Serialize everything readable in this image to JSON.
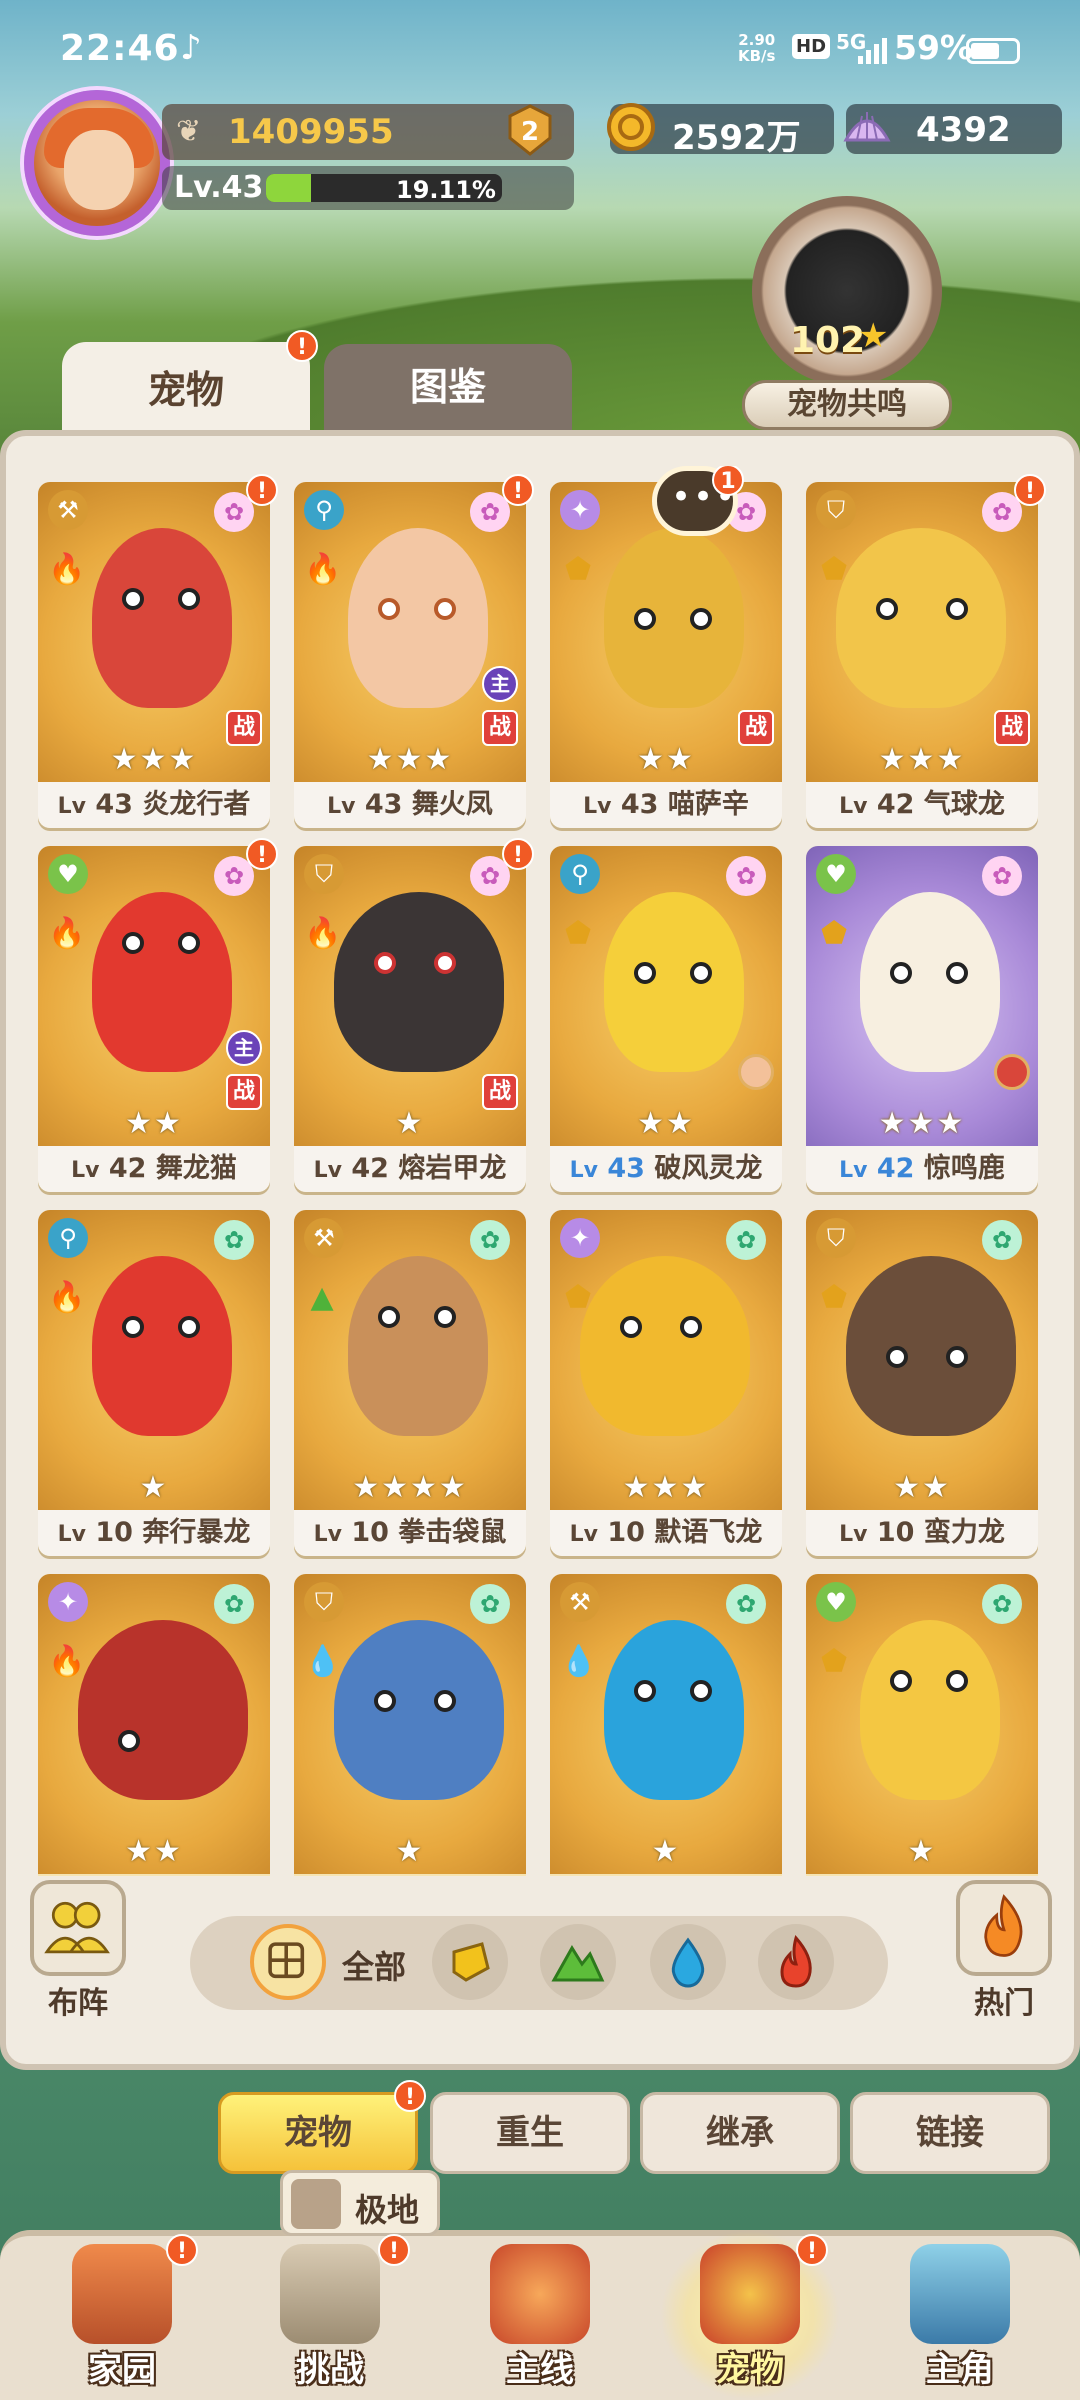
{
  "status_bar": {
    "time": "22:46",
    "net_speed_top": "2.90",
    "net_speed_bottom": "KB/s",
    "hd": "HD",
    "network": "5G",
    "battery": "59%"
  },
  "player": {
    "power": "1409955",
    "rank": "2",
    "level": "Lv.43",
    "xp_percent": "19.11%",
    "xp_fraction": 0.1911
  },
  "currency": {
    "gold": "2592万",
    "shells": "4392"
  },
  "resonance": {
    "count": "102",
    "label": "宠物共鸣"
  },
  "top_tabs": {
    "pets": "宠物",
    "codex": "图鉴"
  },
  "chat_badge": "1",
  "pets": [
    {
      "lv_prefix": "Lv",
      "lv": "43",
      "name": "炎龙行者",
      "stars": "★★★",
      "tag": "战"
    },
    {
      "lv_prefix": "Lv",
      "lv": "43",
      "name": "舞火凤",
      "stars": "★★★",
      "tag": "战",
      "main": "主"
    },
    {
      "lv_prefix": "Lv",
      "lv": "43",
      "name": "喵萨辛",
      "stars": "★★",
      "tag": "战"
    },
    {
      "lv_prefix": "Lv",
      "lv": "42",
      "name": "气球龙",
      "stars": "★★★",
      "tag": "战"
    },
    {
      "lv_prefix": "Lv",
      "lv": "42",
      "name": "舞龙猫",
      "stars": "★★",
      "tag": "战",
      "main": "主"
    },
    {
      "lv_prefix": "Lv",
      "lv": "42",
      "name": "熔岩甲龙",
      "stars": "★",
      "tag": "战"
    },
    {
      "lv_prefix": "Lv",
      "lv": "43",
      "name": "破风灵龙",
      "stars": "★★"
    },
    {
      "lv_prefix": "Lv",
      "lv": "42",
      "name": "惊鸣鹿",
      "stars": "★★★"
    },
    {
      "lv_prefix": "Lv",
      "lv": "10",
      "name": "奔行暴龙",
      "stars": "★"
    },
    {
      "lv_prefix": "Lv",
      "lv": "10",
      "name": "拳击袋鼠",
      "stars": "★★★★"
    },
    {
      "lv_prefix": "Lv",
      "lv": "10",
      "name": "默语飞龙",
      "stars": "★★★"
    },
    {
      "lv_prefix": "Lv",
      "lv": "10",
      "name": "蛮力龙",
      "stars": "★★"
    },
    {
      "lv_prefix": "",
      "lv": "",
      "name": "",
      "stars": "★★"
    },
    {
      "lv_prefix": "",
      "lv": "",
      "name": "",
      "stars": "★"
    },
    {
      "lv_prefix": "",
      "lv": "",
      "name": "",
      "stars": "★"
    },
    {
      "lv_prefix": "",
      "lv": "",
      "name": "",
      "stars": "★"
    }
  ],
  "filter": {
    "lineup": "布阵",
    "all": "全部",
    "hot": "热门"
  },
  "sub_tabs": {
    "pets": "宠物",
    "rebirth": "重生",
    "inherit": "继承",
    "link": "链接"
  },
  "tooltip": "极地",
  "nav": {
    "home": "家园",
    "challenge": "挑战",
    "main_line": "主线",
    "pets": "宠物",
    "hero": "主角"
  },
  "colors": {
    "accent_orange": "#f15a24",
    "card_gold": "#e8a93f",
    "card_purple": "#a98ad8",
    "level_blue": "#3a86d8"
  }
}
